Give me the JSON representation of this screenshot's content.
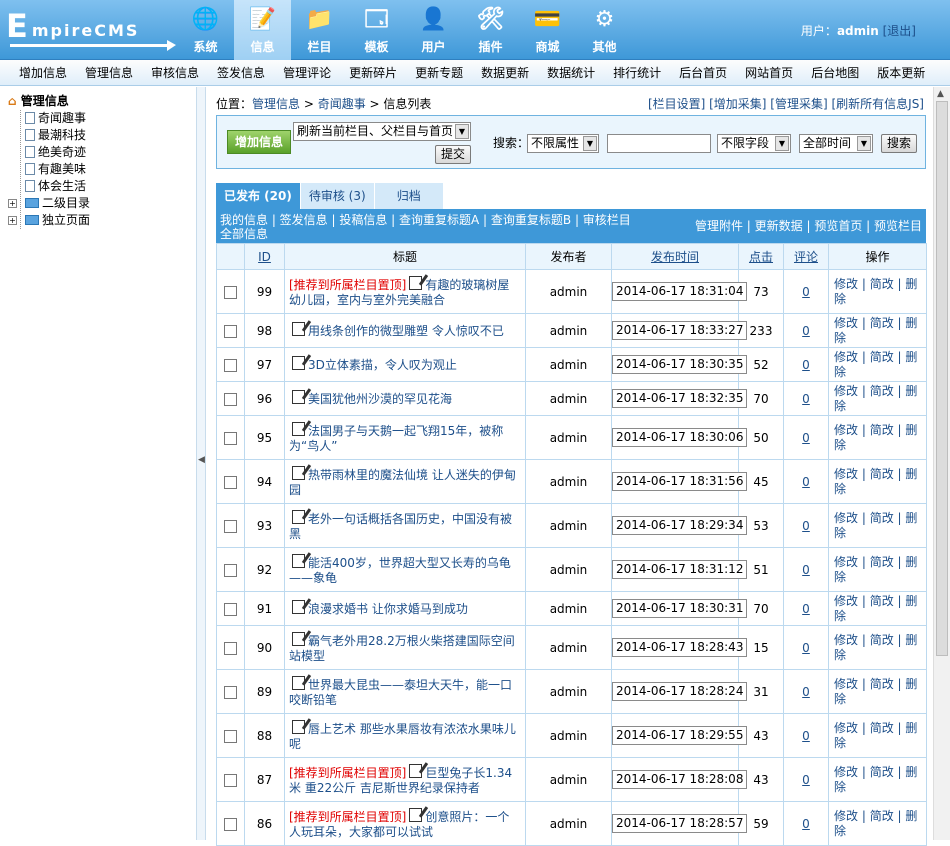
{
  "logo": {
    "first": "E",
    "rest": "mpireCMS"
  },
  "mainnav": [
    {
      "label": "系统",
      "icon": "globe-icon",
      "glyph": "🌐"
    },
    {
      "label": "信息",
      "icon": "notepad-icon",
      "glyph": "📝"
    },
    {
      "label": "栏目",
      "icon": "folder-icon",
      "glyph": "📁"
    },
    {
      "label": "模板",
      "icon": "window-icon",
      "glyph": "🗔"
    },
    {
      "label": "用户",
      "icon": "user-icon",
      "glyph": "👤"
    },
    {
      "label": "插件",
      "icon": "tools-icon",
      "glyph": "🛠"
    },
    {
      "label": "商城",
      "icon": "card-icon",
      "glyph": "💳"
    },
    {
      "label": "其他",
      "icon": "gear-icon",
      "glyph": "⚙"
    }
  ],
  "user": {
    "prefix": "用户：",
    "name": "admin",
    "logout": "[退出]"
  },
  "subnav": [
    "增加信息",
    "管理信息",
    "审核信息",
    "签发信息",
    "管理评论",
    "更新碎片",
    "更新专题",
    "数据更新",
    "数据统计",
    "排行统计",
    "后台首页",
    "网站首页",
    "后台地图",
    "版本更新"
  ],
  "tree": {
    "root": "管理信息",
    "items": [
      "奇闻趣事",
      "最潮科技",
      "绝美奇迹",
      "有趣美味",
      "体会生活"
    ],
    "folders": [
      "二级目录",
      "独立页面"
    ]
  },
  "crumb": {
    "label": "位置：",
    "path1": "管理信息",
    "sep": " > ",
    "path2": "奇闻趣事",
    "path3": "信息列表",
    "links": "[栏目设置] [增加采集] [管理采集] [刷新所有信息JS]"
  },
  "toolbar": {
    "add_label": "增加信息",
    "refresh_select": "刷新当前栏目、父栏目与首页",
    "submit_label": "提交",
    "search_label": "搜索：",
    "attr_select": "不限属性",
    "search_value": "",
    "field_select": "不限字段",
    "time_select": "全部时间",
    "search_button": "搜索"
  },
  "tabs": [
    "已发布 (20)",
    "待审核 (3)",
    "归档"
  ],
  "linkbar": {
    "left": "我的信息 | 签发信息 | 投稿信息 | 查询重复标题A | 查询重复标题B | 审核栏目全部信息",
    "right": "管理附件 | 更新数据 | 预览首页 | 预览栏目"
  },
  "table": {
    "headers": {
      "id": "ID",
      "title": "标题",
      "author": "发布者",
      "time": "发布时间",
      "hits": "点击",
      "comments": "评论",
      "ops": "操作"
    },
    "op_edit": "修改",
    "op_quick": "简改",
    "op_delete": "删除",
    "rows": [
      {
        "id": "99",
        "rec": "[推荐到所属栏目置顶]",
        "title": "有趣的玻璃树屋幼儿园，室内与室外完美融合",
        "author": "admin",
        "time": "2014-06-17 18:31:04",
        "hits": "73",
        "comments": "0"
      },
      {
        "id": "98",
        "rec": "",
        "title": "用线条创作的微型雕塑 令人惊叹不已",
        "author": "admin",
        "time": "2014-06-17 18:33:27",
        "hits": "233",
        "comments": "0"
      },
      {
        "id": "97",
        "rec": "",
        "title": "3D立体素描，令人叹为观止",
        "author": "admin",
        "time": "2014-06-17 18:30:35",
        "hits": "52",
        "comments": "0"
      },
      {
        "id": "96",
        "rec": "",
        "title": "美国犹他州沙漠的罕见花海",
        "author": "admin",
        "time": "2014-06-17 18:32:35",
        "hits": "70",
        "comments": "0"
      },
      {
        "id": "95",
        "rec": "",
        "title": "法国男子与天鹅一起飞翔15年，被称为“鸟人”",
        "author": "admin",
        "time": "2014-06-17 18:30:06",
        "hits": "50",
        "comments": "0"
      },
      {
        "id": "94",
        "rec": "",
        "title": "热带雨林里的魔法仙境 让人迷失的伊甸园",
        "author": "admin",
        "time": "2014-06-17 18:31:56",
        "hits": "45",
        "comments": "0"
      },
      {
        "id": "93",
        "rec": "",
        "title": "老外一句话概括各国历史，中国没有被黑",
        "author": "admin",
        "time": "2014-06-17 18:29:34",
        "hits": "53",
        "comments": "0"
      },
      {
        "id": "92",
        "rec": "",
        "title": "能活400岁，世界超大型又长寿的乌龟——象龟",
        "author": "admin",
        "time": "2014-06-17 18:31:12",
        "hits": "51",
        "comments": "0"
      },
      {
        "id": "91",
        "rec": "",
        "title": "浪漫求婚书 让你求婚马到成功",
        "author": "admin",
        "time": "2014-06-17 18:30:31",
        "hits": "70",
        "comments": "0"
      },
      {
        "id": "90",
        "rec": "",
        "title": "霸气老外用28.2万根火柴搭建国际空间站模型",
        "author": "admin",
        "time": "2014-06-17 18:28:43",
        "hits": "15",
        "comments": "0"
      },
      {
        "id": "89",
        "rec": "",
        "title": "世界最大昆虫——泰坦大天牛，能一口咬断铅笔",
        "author": "admin",
        "time": "2014-06-17 18:28:24",
        "hits": "31",
        "comments": "0"
      },
      {
        "id": "88",
        "rec": "",
        "title": "唇上艺术 那些水果唇妆有浓浓水果味儿呢",
        "author": "admin",
        "time": "2014-06-17 18:29:55",
        "hits": "43",
        "comments": "0"
      },
      {
        "id": "87",
        "rec": "[推荐到所属栏目置顶]",
        "title": "巨型兔子长1.34米 重22公斤 吉尼斯世界纪录保持者",
        "author": "admin",
        "time": "2014-06-17 18:28:08",
        "hits": "43",
        "comments": "0"
      },
      {
        "id": "86",
        "rec": "[推荐到所属栏目置顶]",
        "title": "创意照片：一个人玩耳朵，大家都可以试试",
        "author": "admin",
        "time": "2014-06-17 18:28:57",
        "hits": "59",
        "comments": "0"
      }
    ]
  },
  "colors": {
    "header_blue": "#3e98d8",
    "link_blue": "#1d4f8a",
    "recommend_red": "#e00000",
    "add_green": "#5aa12a"
  }
}
